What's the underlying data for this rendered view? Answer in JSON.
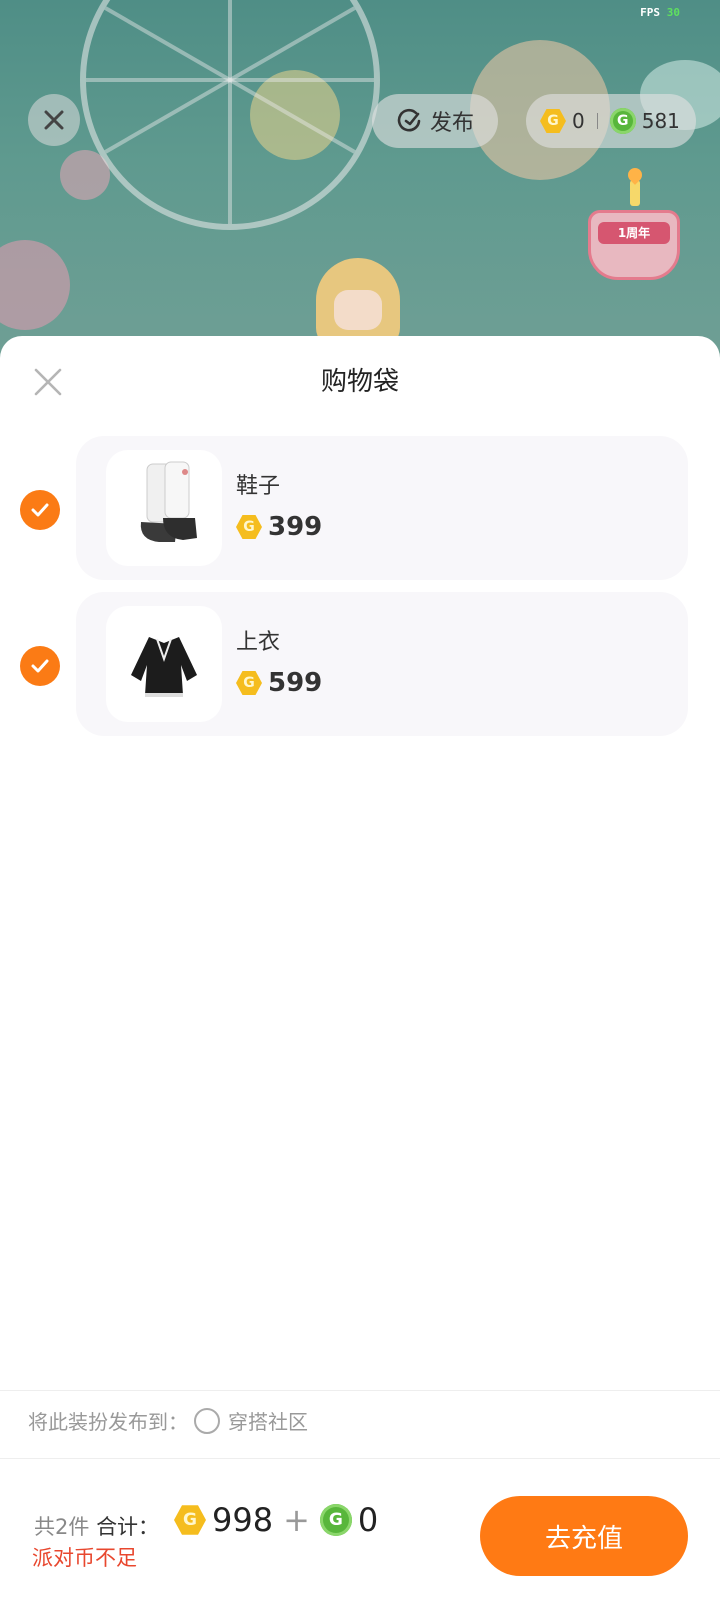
{
  "status": {
    "fps_label": "FPS",
    "fps_value": "30"
  },
  "top_bar": {
    "publish_label": "发布",
    "gold_balance": "0",
    "green_balance": "581"
  },
  "scene": {
    "cake_text": "1周年"
  },
  "sheet": {
    "title": "购物袋",
    "items": [
      {
        "name": "鞋子",
        "price": "399",
        "selected": true
      },
      {
        "name": "上衣",
        "price": "599",
        "selected": true
      }
    ],
    "publish_to_label": "将此装扮发布到：",
    "publish_option_label": "穿搭社区"
  },
  "footer": {
    "count_label": "共2件",
    "total_label": "合计：",
    "gold_total": "998",
    "plus": "+",
    "green_total": "0",
    "warning": "派对币不足",
    "recharge_label": "去充值"
  },
  "colors": {
    "accent": "#ff7a14",
    "warning": "#e8472e",
    "gold_coin": "#f5bd1e",
    "green_coin": "#58b63b"
  }
}
